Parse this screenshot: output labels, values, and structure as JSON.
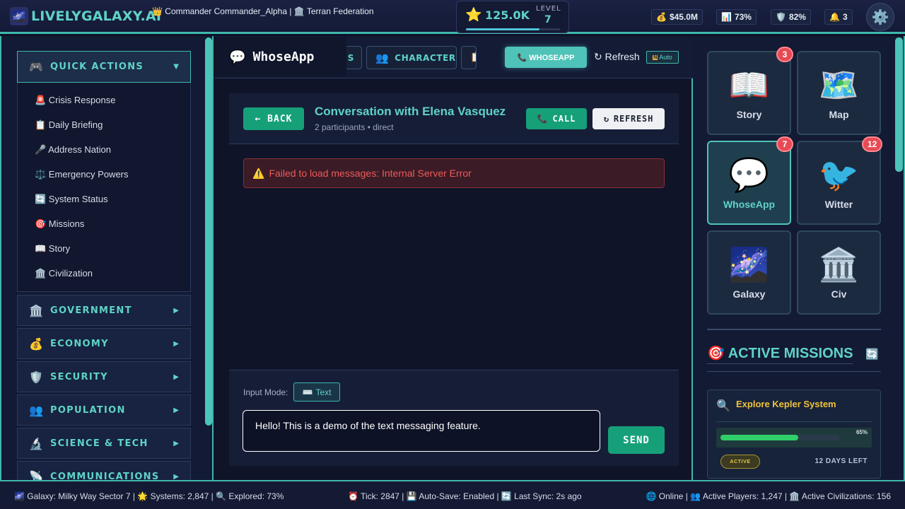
{
  "topbar": {
    "logo_icon": "🌌",
    "logo_text": "LIVELYGALAXY.AI",
    "commander_line": "👑 Commander Commander_Alpha | 🏛️ Terran Federation",
    "xp_star": "⭐",
    "xp_value": "125.0K",
    "level_label": "LEVEL",
    "level_value": "7",
    "xp_progress_percent": 78,
    "stats": [
      {
        "icon": "💰",
        "value": "$45.0M"
      },
      {
        "icon": "📊",
        "value": "73%"
      },
      {
        "icon": "🛡️",
        "value": "82%"
      },
      {
        "icon": "🔔",
        "value": "3"
      }
    ],
    "settings_icon": "⚙️"
  },
  "sidebar": {
    "quick_actions": {
      "icon": "🎮",
      "label": "QUICK ACTIONS",
      "arrow": "▼"
    },
    "quick_items": [
      "🚨 Crisis Response",
      "📋 Daily Briefing",
      "🎤 Address Nation",
      "⚖️ Emergency Powers",
      "🔄 System Status",
      "🎯 Missions",
      "📖 Story",
      "🏛️ Civilization"
    ],
    "sections": [
      {
        "icon": "🏛️",
        "label": "GOVERNMENT",
        "arrow": "▶"
      },
      {
        "icon": "💰",
        "label": "ECONOMY",
        "arrow": "▶"
      },
      {
        "icon": "🛡️",
        "label": "SECURITY",
        "arrow": "▶"
      },
      {
        "icon": "👥",
        "label": "POPULATION",
        "arrow": "▶"
      },
      {
        "icon": "🔬",
        "label": "SCIENCE & TECH",
        "arrow": "▶"
      },
      {
        "icon": "📡",
        "label": "COMMUNICATIONS",
        "arrow": "▶"
      }
    ]
  },
  "center": {
    "app_icon": "💬",
    "app_title": "WhoseApp",
    "tabs": [
      {
        "icon": "",
        "label": "S"
      },
      {
        "icon": "👥",
        "label": "CHARACTERS"
      },
      {
        "icon": "📋",
        "label": ""
      }
    ],
    "whoseapp_button": "📞 WHOSEAPP",
    "refresh_link": "↻ Refresh",
    "auto_badge_icon": "N",
    "auto_label": "Auto",
    "back_label": "← BACK",
    "conversation_title": "Conversation with Elena Vasquez",
    "conversation_sub": "2 participants • direct",
    "call_icon": "📞",
    "call_label": "CALL",
    "refresh_icon": "↻",
    "refresh_label": "REFRESH",
    "error_icon": "⚠️",
    "error_text": "Failed to load messages: Internal Server Error",
    "input_mode_label": "Input Mode:",
    "input_mode_icon": "⌨️",
    "input_mode_value": "Text",
    "message_value": "Hello! This is a demo of the text messaging feature.",
    "send_label": "SEND"
  },
  "right": {
    "apps": [
      {
        "icon": "📖",
        "label": "Story",
        "badge": "3"
      },
      {
        "icon": "🗺️",
        "label": "Map",
        "badge": ""
      },
      {
        "icon": "💬",
        "label": "WhoseApp",
        "badge": "7"
      },
      {
        "icon": "🐦",
        "label": "Witter",
        "badge": "12"
      },
      {
        "icon": "🌌",
        "label": "Galaxy",
        "badge": ""
      },
      {
        "icon": "🏛️",
        "label": "Civ",
        "badge": ""
      }
    ],
    "missions_title": "🎯 ACTIVE MISSIONS",
    "missions_refresh_icon": "🔄",
    "mission": {
      "icon": "🔍",
      "title": "Explore Kepler System",
      "progress_label": "65%",
      "progress_percent": 65,
      "status": "ACTIVE",
      "days_left": "12 DAYS LEFT"
    }
  },
  "footer": {
    "left": "🌌 Galaxy: Milky Way Sector 7 | 🌟 Systems: 2,847 | 🔍 Explored: 73%",
    "middle": "⏰ Tick: 2847 | 💾 Auto-Save: Enabled | 🔄 Last Sync: 2s ago",
    "right": "🌐 Online | 👥 Active Players: 1,247 | 🏛️ Active Civilizations: 156"
  }
}
